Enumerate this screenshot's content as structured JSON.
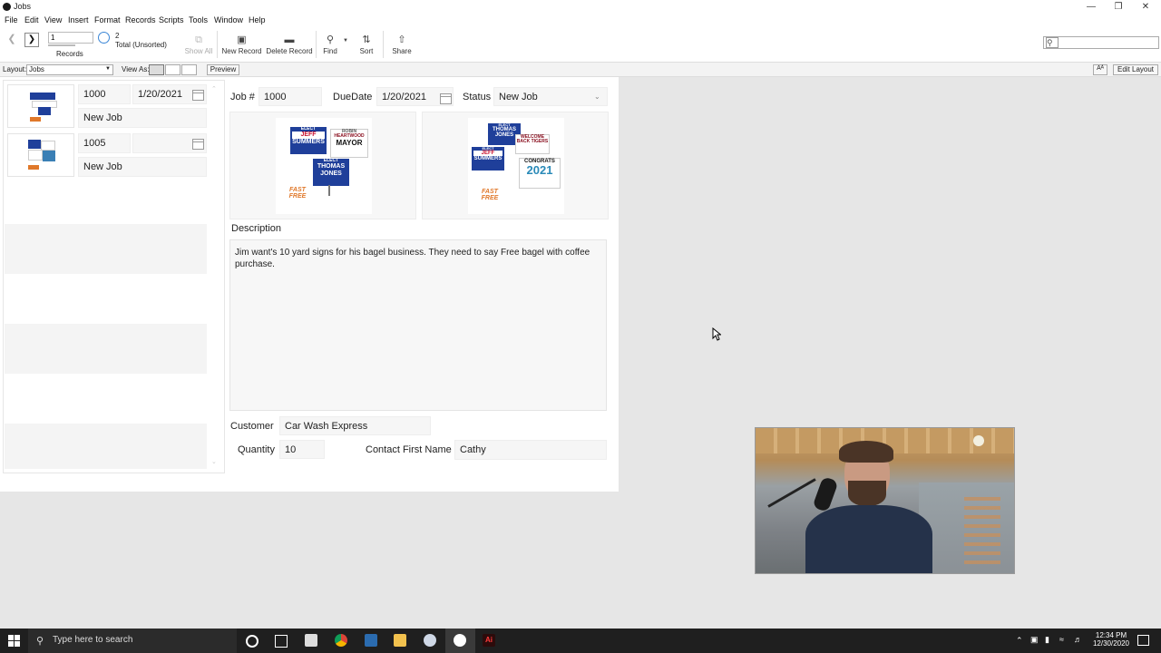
{
  "window": {
    "title": "Jobs",
    "app_icon": "filemaker-icon"
  },
  "menu": [
    "File",
    "Edit",
    "View",
    "Insert",
    "Format",
    "Records",
    "Scripts",
    "Tools",
    "Window",
    "Help"
  ],
  "toolbar": {
    "record_value": "1",
    "records_label": "Records",
    "total_count": "2",
    "total_label": "Total (Unsorted)",
    "show_all": "Show All",
    "new_record": "New Record",
    "delete_record": "Delete Record",
    "find": "Find",
    "sort": "Sort",
    "share": "Share"
  },
  "layoutbar": {
    "layout_label": "Layout:",
    "layout_value": "Jobs",
    "view_as_label": "View As:",
    "preview": "Preview",
    "aa": "Aᴬ",
    "edit_layout": "Edit Layout"
  },
  "list": [
    {
      "job": "1000",
      "date": "1/20/2021",
      "status": "New Job"
    },
    {
      "job": "1005",
      "date": "",
      "status": "New Job"
    }
  ],
  "detail": {
    "job_label": "Job #",
    "job_value": "1000",
    "due_label": "DueDate",
    "due_value": "1/20/2021",
    "status_label": "Status",
    "status_value": "New Job",
    "description_label": "Description",
    "description_value": "Jim want's 10 yard signs for his bagel business. They need to say Free bagel with coffee purchase.",
    "customer_label": "Customer",
    "customer_value": "Car Wash Express",
    "quantity_label": "Quantity",
    "quantity_value": "10",
    "contact_label": "Contact First Name",
    "contact_value": "Cathy"
  },
  "signs": {
    "elect": "ELECT",
    "jeff": "JEFF",
    "summers": "SUMMERS",
    "mayor": "MAYOR",
    "robin": "ROBIN",
    "heartwood": "HEARTWOOD",
    "thomas": "THOMAS",
    "jones": "JONES",
    "fast": "FAST",
    "free": "FREE",
    "welcome": "WELCOME",
    "back_tigers": "BACK TIGERS",
    "congrats": "CONGRATS",
    "year": "2021"
  },
  "taskbar": {
    "search_placeholder": "Type here to search",
    "time": "12:34 PM",
    "date": "12/30/2020"
  },
  "colors": {
    "sign_blue": "#1f3f9a",
    "sign_red": "#c8102e",
    "taskbar": "#1f1f1f"
  }
}
